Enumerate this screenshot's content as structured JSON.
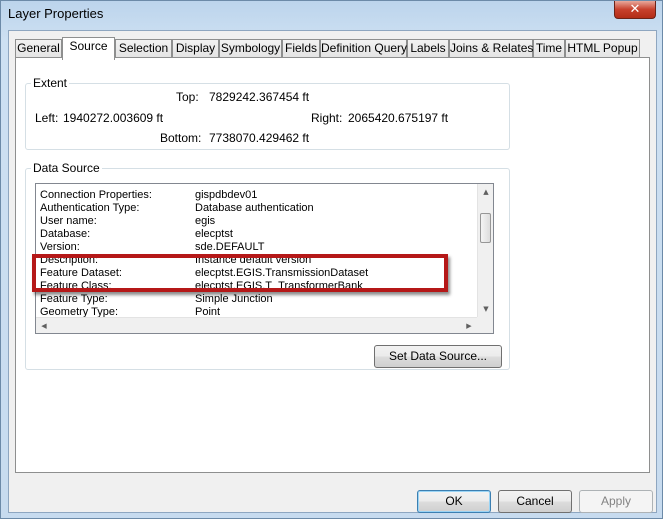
{
  "window": {
    "title": "Layer Properties",
    "close_symbol": "✕"
  },
  "tabs": [
    {
      "label": "General"
    },
    {
      "label": "Source"
    },
    {
      "label": "Selection"
    },
    {
      "label": "Display"
    },
    {
      "label": "Symbology"
    },
    {
      "label": "Fields"
    },
    {
      "label": "Definition Query"
    },
    {
      "label": "Labels"
    },
    {
      "label": "Joins & Relates"
    },
    {
      "label": "Time"
    },
    {
      "label": "HTML Popup"
    }
  ],
  "active_tab": "Source",
  "extent": {
    "title": "Extent",
    "top_label": "Top:",
    "top_value": "7829242.367454 ft",
    "left_label": "Left:",
    "left_value": "1940272.003609 ft",
    "right_label": "Right:",
    "right_value": "2065420.675197 ft",
    "bottom_label": "Bottom:",
    "bottom_value": "7738070.429462 ft"
  },
  "data_source": {
    "title": "Data Source",
    "properties": [
      {
        "key": "Connection Properties:",
        "value": "gispdbdev01"
      },
      {
        "key": "Authentication Type:",
        "value": "Database authentication"
      },
      {
        "key": "User name:",
        "value": "egis"
      },
      {
        "key": "Database:",
        "value": "elecptst"
      },
      {
        "key": "Version:",
        "value": "sde.DEFAULT"
      },
      {
        "key": "Description:",
        "value": "Instance default version"
      },
      {
        "key": "Feature Dataset:",
        "value": "elecptst.EGIS.TransmissionDataset"
      },
      {
        "key": "Feature Class:",
        "value": "elecptst.EGIS.T_TransformerBank"
      },
      {
        "key": "Feature Type:",
        "value": "Simple Junction"
      },
      {
        "key": "Geometry Type:",
        "value": "Point"
      }
    ],
    "set_source_label": "Set Data Source..."
  },
  "footer": {
    "ok_label": "OK",
    "cancel_label": "Cancel",
    "apply_label": "Apply"
  },
  "colors": {
    "highlight_border": "#b51818",
    "default_button_border": "#3c7fb1"
  }
}
